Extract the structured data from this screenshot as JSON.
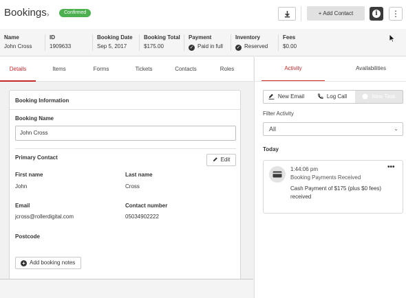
{
  "header": {
    "title": "Bookings",
    "chevron": "›",
    "status_badge": "Confirmed",
    "download_icon": "download-icon",
    "add_contact_label": "+ Add Contact",
    "info_icon_glyph": "i",
    "more_icon_glyph": "⋮"
  },
  "summary": {
    "name": {
      "label": "Name",
      "value": "John Cross"
    },
    "id": {
      "label": "ID",
      "value": "1909633"
    },
    "booking_date": {
      "label": "Booking Date",
      "value": "Sep 5, 2017"
    },
    "booking_total": {
      "label": "Booking Total",
      "value": "$175.00"
    },
    "payment": {
      "label": "Payment",
      "value": "Paid in full"
    },
    "inventory": {
      "label": "Inventory",
      "value": "Reserved"
    },
    "fees": {
      "label": "Fees",
      "value": "$0.00"
    },
    "check_glyph": "✓"
  },
  "left_tabs": [
    "Details",
    "Items",
    "Forms",
    "Tickets",
    "Contacts",
    "Roles"
  ],
  "active_left_tab": "Details",
  "booking_info": {
    "heading": "Booking Information",
    "booking_name_label": "Booking Name",
    "booking_name_value": "John Cross",
    "primary_contact_label": "Primary Contact",
    "edit_label": "Edit",
    "first_name_label": "First name",
    "first_name_value": "John",
    "last_name_label": "Last name",
    "last_name_value": "Cross",
    "email_label": "Email",
    "email_value": "jcross@rollerdigital.com",
    "contact_number_label": "Contact number",
    "contact_number_value": "05034902222",
    "postcode_label": "Postcode",
    "add_notes_label": "Add booking notes",
    "plus_glyph": "+"
  },
  "right_tabs": [
    "Activity",
    "Availabilities"
  ],
  "active_right_tab": "Activity",
  "activity": {
    "new_email_label": "New Email",
    "log_call_label": "Log Call",
    "new_task_label": "New Task",
    "filter_label": "Filter Activity",
    "filter_value": "All",
    "filter_chevron": "⌄",
    "today_label": "Today",
    "card": {
      "time": "1:44:06 pm",
      "title": "Booking Payments Received",
      "description": "Cash Payment of $175 (plus $0 fees) received",
      "more_glyph": "•••",
      "icon": "credit-card-icon"
    }
  },
  "colors": {
    "accent": "#c62828",
    "badge": "#4caf50"
  }
}
